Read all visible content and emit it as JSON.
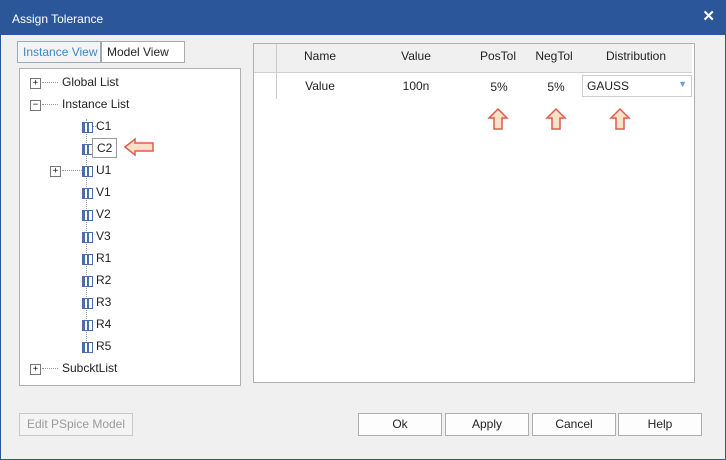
{
  "window": {
    "title": "Assign Tolerance",
    "close_icon": "✕"
  },
  "tabs": [
    {
      "label": "Instance View",
      "active": true
    },
    {
      "label": "Model View",
      "active": false
    }
  ],
  "tree": {
    "global": "Global List",
    "instance": "Instance List",
    "subckt": "SubcktList",
    "items": [
      "C1",
      "C2",
      "U1",
      "V1",
      "V2",
      "V3",
      "R1",
      "R2",
      "R3",
      "R4",
      "R5"
    ],
    "selected": "C2"
  },
  "grid": {
    "headers": [
      "Name",
      "Value",
      "PosTol",
      "NegTol",
      "Distribution"
    ],
    "row": {
      "name": "Value",
      "value": "100n",
      "postol": "5%",
      "negtol": "5%",
      "distribution": "GAUSS"
    }
  },
  "buttons": {
    "edit_model": "Edit PSpice Model",
    "ok": "Ok",
    "apply": "Apply",
    "cancel": "Cancel",
    "help": "Help"
  },
  "colors": {
    "titlebar": "#2b579a",
    "arrow_fill": "#fde0c8",
    "arrow_stroke": "#e05a4a",
    "active_tab": "#3a88c8"
  }
}
